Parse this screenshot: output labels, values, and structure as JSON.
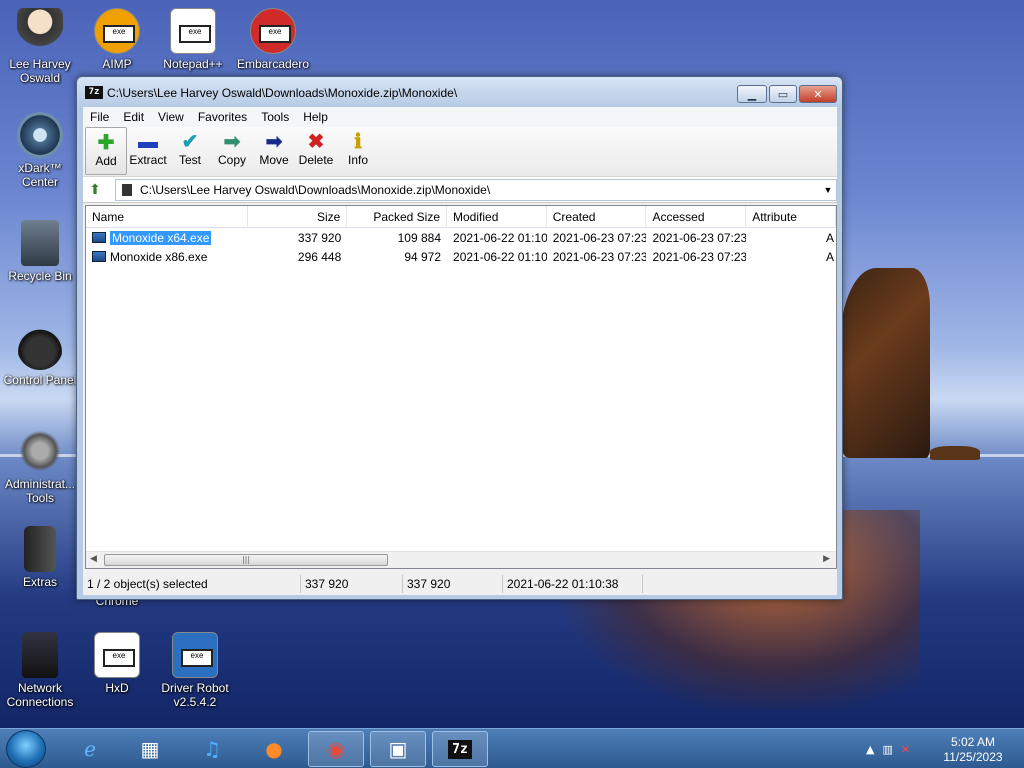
{
  "desktop_icons": [
    {
      "label": "Lee Harvey Oswald",
      "icon": "user-figure-icon"
    },
    {
      "label": "AIMP",
      "icon": "aimp-icon"
    },
    {
      "label": "Notepad++",
      "icon": "notepadpp-icon"
    },
    {
      "label": "Embarcadero",
      "icon": "embarcadero-icon"
    },
    {
      "label": "xDark™ Center",
      "icon": "xdark-icon"
    },
    {
      "label": "Recycle Bin",
      "icon": "recycle-bin-icon"
    },
    {
      "label": "Control Panel",
      "icon": "control-panel-icon"
    },
    {
      "label": "Administrat... Tools",
      "icon": "admin-tools-icon"
    },
    {
      "label": "Extras",
      "icon": "extras-icon"
    },
    {
      "label": "Chrome",
      "icon": "chrome-icon"
    },
    {
      "label": "Network Connections",
      "icon": "network-icon"
    },
    {
      "label": "HxD",
      "icon": "hxd-icon"
    },
    {
      "label": "Driver Robot v2.5.4.2",
      "icon": "driver-robot-icon"
    }
  ],
  "window": {
    "app_icon_text": "7z",
    "title": "C:\\Users\\Lee Harvey Oswald\\Downloads\\Monoxide.zip\\Monoxide\\",
    "menu": [
      "File",
      "Edit",
      "View",
      "Favorites",
      "Tools",
      "Help"
    ],
    "toolbar": [
      {
        "label": "Add",
        "glyph": "✚",
        "color": "#2aa52a"
      },
      {
        "label": "Extract",
        "glyph": "▬",
        "color": "#1f3fbf"
      },
      {
        "label": "Test",
        "glyph": "✔",
        "color": "#1fa0b0"
      },
      {
        "label": "Copy",
        "glyph": "➡",
        "color": "#2f8f6f"
      },
      {
        "label": "Move",
        "glyph": "➡",
        "color": "#1a2a8a"
      },
      {
        "label": "Delete",
        "glyph": "✖",
        "color": "#d02020"
      },
      {
        "label": "Info",
        "glyph": "ℹ",
        "color": "#c8a000"
      }
    ],
    "address": "C:\\Users\\Lee Harvey Oswald\\Downloads\\Monoxide.zip\\Monoxide\\",
    "columns": [
      "Name",
      "Size",
      "Packed Size",
      "Modified",
      "Created",
      "Accessed",
      "Attribute"
    ],
    "rows": [
      {
        "name": "Monoxide x64.exe",
        "size": "337 920",
        "packed": "109 884",
        "modified": "2021-06-22 01:10",
        "created": "2021-06-23 07:23",
        "accessed": "2021-06-23 07:23",
        "attr": "A",
        "selected": true
      },
      {
        "name": "Monoxide x86.exe",
        "size": "296 448",
        "packed": "94 972",
        "modified": "2021-06-22 01:10",
        "created": "2021-06-23 07:23",
        "accessed": "2021-06-23 07:23",
        "attr": "A",
        "selected": false
      }
    ],
    "status": {
      "selection": "1 / 2 object(s) selected",
      "size": "337 920",
      "packed": "337 920",
      "date": "2021-06-22 01:10:38"
    }
  },
  "taskbar": {
    "items": [
      "ie-icon",
      "winrar-icon",
      "music-icon",
      "firefox-icon",
      "chrome-icon",
      "network-setup-icon",
      "7zip-icon"
    ],
    "zip_label": "7z",
    "clock_time": "5:02 AM",
    "clock_date": "11/25/2023"
  }
}
